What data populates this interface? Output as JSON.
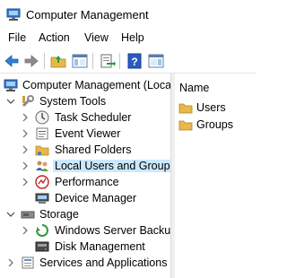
{
  "window": {
    "title": "Computer Management"
  },
  "menu": {
    "file": "File",
    "action": "Action",
    "view": "View",
    "help": "Help"
  },
  "tree": {
    "root": "Computer Management (Local",
    "system_tools": "System Tools",
    "task_scheduler": "Task Scheduler",
    "event_viewer": "Event Viewer",
    "shared_folders": "Shared Folders",
    "local_users": "Local Users and Groups",
    "performance": "Performance",
    "device_manager": "Device Manager",
    "storage": "Storage",
    "wsb": "Windows Server Backup",
    "disk_mgmt": "Disk Management",
    "services": "Services and Applications"
  },
  "list": {
    "column_name": "Name",
    "items": [
      "Users",
      "Groups"
    ]
  },
  "colors": {
    "selection": "#cce8ff",
    "accent": "#1e6fd0",
    "folder": "#e8b84a"
  }
}
